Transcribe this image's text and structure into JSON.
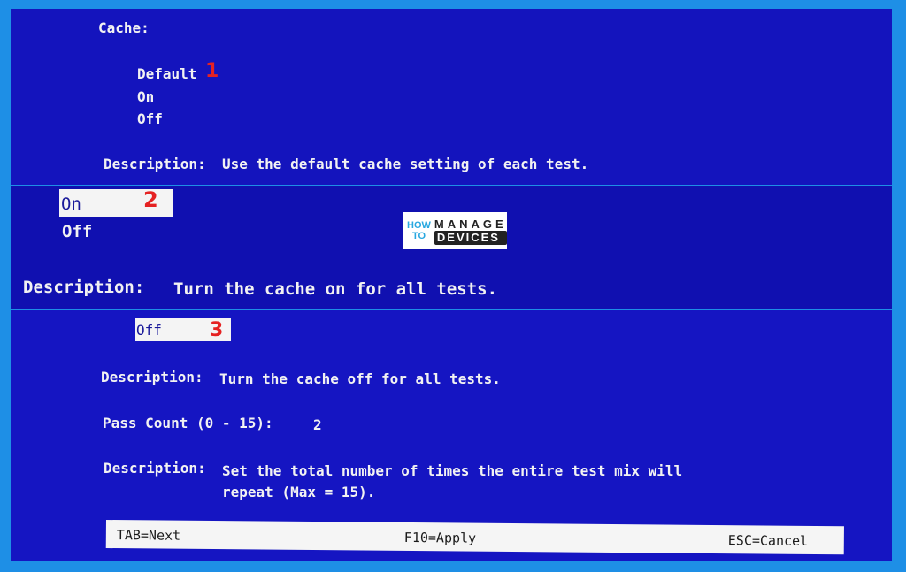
{
  "panel1": {
    "heading": "Cache:",
    "options": [
      "Default",
      "On",
      "Off"
    ],
    "marker": "1",
    "description_label": "Description:",
    "description_text": "Use the default cache setting of each test."
  },
  "panel2": {
    "selected_option": "On",
    "other_option": "Off",
    "marker": "2",
    "description_label": "Description:",
    "description_text": "Turn the cache on for all tests."
  },
  "panel3": {
    "selected_option": "Off",
    "marker": "3",
    "description_label": "Description:",
    "description_text": "Turn the cache off for all tests.",
    "pass_count_label": "Pass Count (0 - 15):",
    "pass_count_value": "2",
    "description2_label": "Description:",
    "description2_line1": "Set the total number of times the entire test mix will",
    "description2_line2": "repeat (Max = 15)."
  },
  "logo": {
    "how": "HOW",
    "to": "TO",
    "manage": "MANAGE",
    "devices": "DEVICES"
  },
  "footer": {
    "next": "TAB=Next",
    "apply": "F10=Apply",
    "cancel": "ESC=Cancel"
  },
  "colors": {
    "screen_blue": "#1414bd",
    "border_blue": "#1e8fe6",
    "highlight": "#f4f4f4",
    "marker_red": "#e52222"
  }
}
